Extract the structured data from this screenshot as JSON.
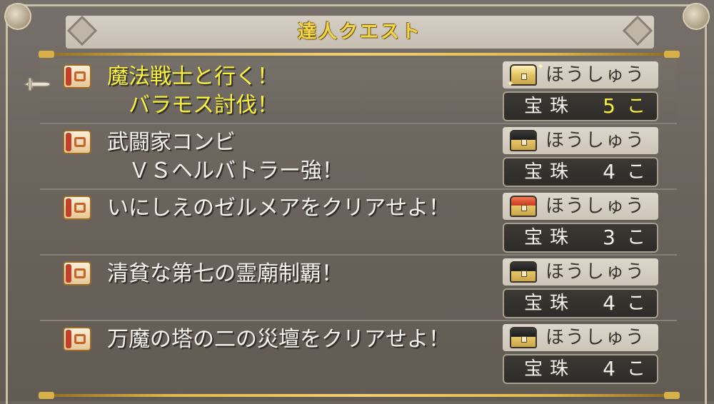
{
  "header": {
    "title": "達人クエスト"
  },
  "quests": [
    {
      "name": "魔法戦士と行く！\n　バラモス討伐！",
      "reward_label": "ほうしゅう",
      "reward_item": "宝珠",
      "reward_count": "5",
      "reward_unit": "こ",
      "chest": "gold",
      "selected": true
    },
    {
      "name": "武闘家コンビ\n　ＶＳヘルバトラー強！",
      "reward_label": "ほうしゅう",
      "reward_item": "宝珠",
      "reward_count": "4",
      "reward_unit": "こ",
      "chest": "black",
      "selected": false
    },
    {
      "name": "いにしえのゼルメアをクリアせよ！",
      "reward_label": "ほうしゅう",
      "reward_item": "宝珠",
      "reward_count": "3",
      "reward_unit": "こ",
      "chest": "red",
      "selected": false
    },
    {
      "name": "清貧な第七の霊廟制覇！",
      "reward_label": "ほうしゅう",
      "reward_item": "宝珠",
      "reward_count": "4",
      "reward_unit": "こ",
      "chest": "black",
      "selected": false
    },
    {
      "name": "万魔の塔の二の災壇をクリアせよ！",
      "reward_label": "ほうしゅう",
      "reward_item": "宝珠",
      "reward_count": "4",
      "reward_unit": "こ",
      "chest": "black",
      "selected": false
    }
  ],
  "colors": {
    "title_gold": "#f3d54a",
    "selected_text": "#f7f03c",
    "normal_text": "#f4f1ec",
    "panel_bg": "#6b645c"
  },
  "icons": {
    "quest": "scroll-icon",
    "reward": "treasure-chest-icon",
    "cursor": "hand-pointer-icon"
  }
}
